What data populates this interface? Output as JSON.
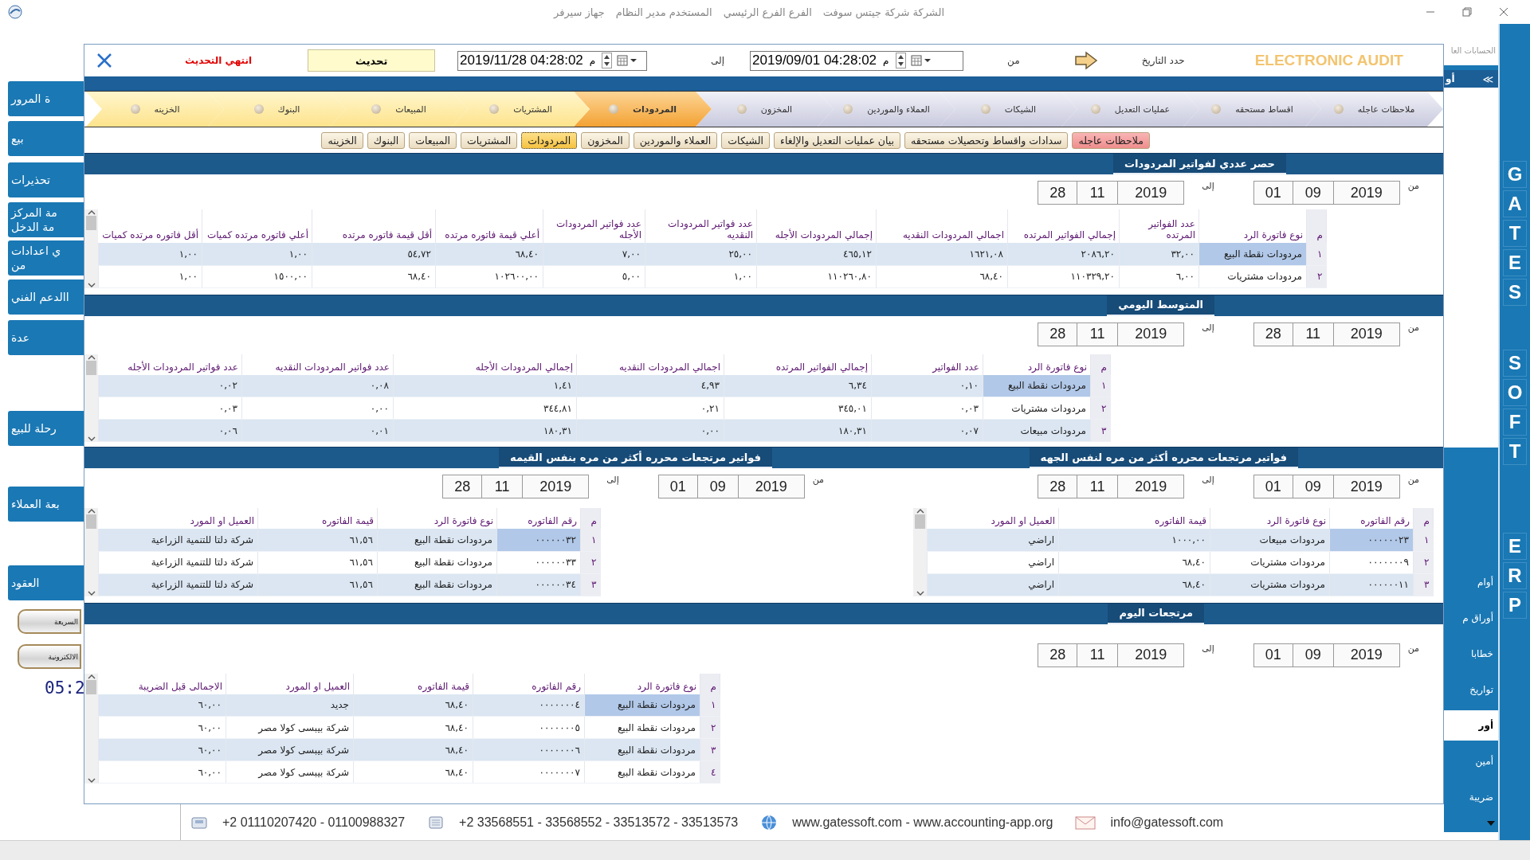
{
  "window": {
    "title_parts": [
      "الشركة شركة جيتس سوفت",
      "الفرع الفرع الرئيسي",
      "المستخدم مدير النظام",
      "جهاز سيرفر"
    ]
  },
  "left_sidebar": {
    "items": [
      {
        "lines": [
          "ة المرور"
        ]
      },
      {
        "lines": [
          "بيع"
        ]
      },
      {
        "lines": [
          "تحذيرات"
        ]
      },
      {
        "lines": [
          "مة المركز",
          "مة الدخل"
        ]
      },
      {
        "lines": [
          "ي اعدادات",
          "من"
        ]
      },
      {
        "lines": [
          "االدعم الفني"
        ]
      },
      {
        "lines": [
          "عدة"
        ]
      },
      {
        "lines": [
          "رحلة للبيع"
        ]
      },
      {
        "lines": [
          "بعة العملاء"
        ]
      },
      {
        "lines": [
          "العقود"
        ]
      }
    ],
    "quick_buttons": [
      "السريعة",
      "الالكترونية"
    ],
    "clock": "05:2"
  },
  "toolbar": {
    "status": "انتهي التحديث",
    "refresh_button": "تحديث",
    "to_date": {
      "value": "2019/11/28 04:28:02",
      "period": "م"
    },
    "to_label": "إلى",
    "from_date": {
      "value": "2019/09/01 04:28:02",
      "period": "م"
    },
    "from_label": "من",
    "date_label": "حدد التاريخ",
    "brand": "ELECTRONIC AUDIT"
  },
  "steps": [
    {
      "label": "ملاحظات عاجله",
      "selected": false
    },
    {
      "label": "اقساط مستحقه",
      "selected": false
    },
    {
      "label": "عمليات التعديل",
      "selected": false
    },
    {
      "label": "الشيكات",
      "selected": false
    },
    {
      "label": "العملاء والموردين",
      "selected": false
    },
    {
      "label": "المخزون",
      "selected": false
    },
    {
      "label": "المردودات",
      "selected": true
    },
    {
      "label": "المشتريات",
      "selected": false
    },
    {
      "label": "المبيعات",
      "selected": false
    },
    {
      "label": "البنوك",
      "selected": false
    },
    {
      "label": "الخزينه",
      "selected": false
    }
  ],
  "tabs": [
    {
      "label": "ملاحظات عاجله",
      "selected": false,
      "alert": true
    },
    {
      "label": "سدادات واقساط  وتحصيلات مستحقه",
      "selected": false,
      "alert": false
    },
    {
      "label": "بيان عمليات التعديل والإلغاء",
      "selected": false,
      "alert": false
    },
    {
      "label": "الشيكات",
      "selected": false,
      "alert": false
    },
    {
      "label": "العملاء والموردين",
      "selected": false,
      "alert": false
    },
    {
      "label": "المخزون",
      "selected": false,
      "alert": false
    },
    {
      "label": "المردودات",
      "selected": true,
      "alert": false
    },
    {
      "label": "المشتريات",
      "selected": false,
      "alert": false
    },
    {
      "label": "المبيعات",
      "selected": false,
      "alert": false
    },
    {
      "label": "البنوك",
      "selected": false,
      "alert": false
    },
    {
      "label": "الخزينه",
      "selected": false,
      "alert": false
    }
  ],
  "sections": [
    {
      "panels": [
        {
          "title": "حصر عددي لفواتير المردودات",
          "from_label": "من",
          "from": {
            "year": "2019",
            "month": "09",
            "day": "01"
          },
          "to_label": "إلى",
          "to": {
            "year": "2019",
            "month": "11",
            "day": "28"
          },
          "columns": [
            "م",
            "نوع فاتورة الرد",
            "عدد الفواتير المرتده",
            "إجمالي الفواتير المرتده",
            "اجمالي المردودات النقديه",
            "إجمالي المردودات الأجله",
            "عدد فواتير المردودات النقديه",
            "عدد فواتير المردودات الأجله",
            "أعلي قيمة فاتوره مرتده",
            "أقل قيمة فاتوره مرتده",
            "أعلي فاتوره مرتده كميات",
            "أقل فاتوره مرتده كميات"
          ],
          "rows": [
            {
              "selected": true,
              "cells": [
                "١",
                "مردودات نقطة البيع",
                "٣٢,٠٠",
                "٢٠٨٦,٢٠",
                "١٦٢١,٠٨",
                "٤٦٥,١٢",
                "٢٥,٠٠",
                "٧,٠٠",
                "٦٨,٤٠",
                "٥٤,٧٢",
                "١,٠٠",
                "١,٠٠"
              ]
            },
            {
              "selected": false,
              "cells": [
                "٢",
                "مردودات مشتريات",
                "٦,٠٠",
                "١١٠٣٢٩,٢٠",
                "٦٨,٤٠",
                "١١٠٢٦٠,٨٠",
                "١,٠٠",
                "٥,٠٠",
                "١٠٢٦٠٠,٠٠",
                "٦٨,٤٠",
                "١٥٠٠,٠٠",
                "١,٠٠"
              ]
            }
          ]
        }
      ]
    },
    {
      "panels": [
        {
          "title": "المتوسط اليومي",
          "from_label": "من",
          "from": {
            "year": "2019",
            "month": "11",
            "day": "28"
          },
          "to_label": "إلى",
          "to": {
            "year": "2019",
            "month": "11",
            "day": "28"
          },
          "columns": [
            "م",
            "نوع فاتورة الرد",
            "عدد الفواتير",
            "إجمالي الفواتير المرتده",
            "اجمالي المردودات النقديه",
            "إجمالي المردودات الأجله",
            "عدد فواتير المردودات النقديه",
            "عدد فواتير المردودات الأجله"
          ],
          "rows": [
            {
              "selected": true,
              "cells": [
                "١",
                "مردودات نقطة البيع",
                "٠,١٠",
                "٦,٣٤",
                "٤,٩٣",
                "١,٤١",
                "٠,٠٨",
                "٠,٠٢"
              ]
            },
            {
              "selected": false,
              "cells": [
                "٢",
                "مردودات مشتريات",
                "٠,٠٣",
                "٣٤٥,٠١",
                "٠,٢١",
                "٣٤٤,٨١",
                "٠,٠٠",
                "٠,٠٣"
              ]
            },
            {
              "selected": false,
              "cells": [
                "٣",
                "مردودات مبيعات",
                "٠,٠٧",
                "١٨٠,٣١",
                "٠,٠٠",
                "١٨٠,٣١",
                "٠,٠١",
                "٠,٠٦"
              ]
            }
          ]
        }
      ]
    },
    {
      "panels": [
        {
          "title": "فواتير مرتجعات محرره أكثر من مره لنفس الجهه",
          "from_label": "من",
          "from": {
            "year": "2019",
            "month": "09",
            "day": "01"
          },
          "to_label": "إلى",
          "to": {
            "year": "2019",
            "month": "11",
            "day": "28"
          },
          "columns": [
            "م",
            "رقم الفاتوره",
            "نوع فاتورة الرد",
            "قيمة الفاتوره",
            "العميل او المورد"
          ],
          "rows": [
            {
              "selected": true,
              "cells": [
                "١",
                "٠٠٠٠٠٠٢٣",
                "مردودات مبيعات",
                "١٠٠٠,٠٠",
                "اراضي"
              ]
            },
            {
              "selected": false,
              "cells": [
                "٢",
                "٠٠٠٠٠٠٠٩",
                "مردودات مشتريات",
                "٦٨,٤٠",
                "اراضي"
              ]
            },
            {
              "selected": false,
              "cells": [
                "٣",
                "٠٠٠٠٠٠١١",
                "مردودات مشتريات",
                "٦٨,٤٠",
                "اراضي"
              ]
            }
          ]
        },
        {
          "title": "فواتير مرتجعات محرره أكثر من مره بنفس القيمه",
          "from_label": "من",
          "from": {
            "year": "2019",
            "month": "09",
            "day": "01"
          },
          "to_label": "إلى",
          "to": {
            "year": "2019",
            "month": "11",
            "day": "28"
          },
          "columns": [
            "م",
            "رقم الفاتوره",
            "نوع فاتورة الرد",
            "قيمة الفاتوره",
            "العميل او المورد"
          ],
          "rows": [
            {
              "selected": true,
              "cells": [
                "١",
                "٠٠٠٠٠٠٣٢",
                "مردودات نقطة البيع",
                "٦١,٥٦",
                "شركة دلتا للتنمية الزراعية"
              ]
            },
            {
              "selected": false,
              "cells": [
                "٢",
                "٠٠٠٠٠٠٣٣",
                "مردودات نقطة البيع",
                "٦١,٥٦",
                "شركة دلتا للتنمية الزراعية"
              ]
            },
            {
              "selected": false,
              "cells": [
                "٣",
                "٠٠٠٠٠٠٣٤",
                "مردودات نقطة البيع",
                "٦١,٥٦",
                "شركة دلتا للتنمية الزراعية"
              ]
            }
          ]
        }
      ]
    },
    {
      "panels": [
        {
          "title": "مرتجعات اليوم",
          "from_label": "من",
          "from": {
            "year": "2019",
            "month": "09",
            "day": "01"
          },
          "to_label": "إلى",
          "to": {
            "year": "2019",
            "month": "11",
            "day": "28"
          },
          "columns": [
            "م",
            "نوع فاتورة الرد",
            "رقم الفاتوره",
            "قيمة الفاتوره",
            "العميل او المورد",
            "الاجمالى قبل الضريبة"
          ],
          "rows": [
            {
              "selected": true,
              "cells": [
                "١",
                "مردودات نقطة البيع",
                "٠٠٠٠٠٠٠٤",
                "٦٨,٤٠",
                "جديد",
                "٦٠,٠٠"
              ]
            },
            {
              "selected": false,
              "cells": [
                "٢",
                "مردودات نقطة البيع",
                "٠٠٠٠٠٠٠٥",
                "٦٨,٤٠",
                "شركة بيبسى كولا مصر",
                "٦٠,٠٠"
              ]
            },
            {
              "selected": false,
              "cells": [
                "٣",
                "مردودات نقطة البيع",
                "٠٠٠٠٠٠٠٦",
                "٦٨,٤٠",
                "شركة بيبسى كولا مصر",
                "٦٠,٠٠"
              ]
            },
            {
              "selected": false,
              "cells": [
                "٤",
                "مردودات نقطة البيع",
                "٠٠٠٠٠٠٠٧",
                "٦٨,٤٠",
                "شركة بيبسى كولا مصر",
                "٦٠,٠٠"
              ]
            }
          ]
        }
      ]
    }
  ],
  "footer": {
    "mobile": "+2 01110207420 - 01100988327",
    "phones": "+2 33568551 - 33568552 - 33513572 - 33513573",
    "websites": "www.gatessoft.com  -  www.accounting-app.org",
    "email": "info@gatessoft.com"
  },
  "right_panel": {
    "caption": "الحسابات العا",
    "header": "أو",
    "collapse": "≪",
    "items": [
      {
        "label": "أوام",
        "selected": false
      },
      {
        "label": "أوراق م",
        "selected": false
      },
      {
        "label": "خطابا",
        "selected": false
      },
      {
        "label": "تواريخ",
        "selected": false
      },
      {
        "label": "أور",
        "selected": true
      },
      {
        "label": "أمين",
        "selected": false
      },
      {
        "label": "ضريبة",
        "selected": false
      }
    ]
  },
  "brand_strip": [
    "GATES",
    "SOFT",
    "ERP"
  ]
}
